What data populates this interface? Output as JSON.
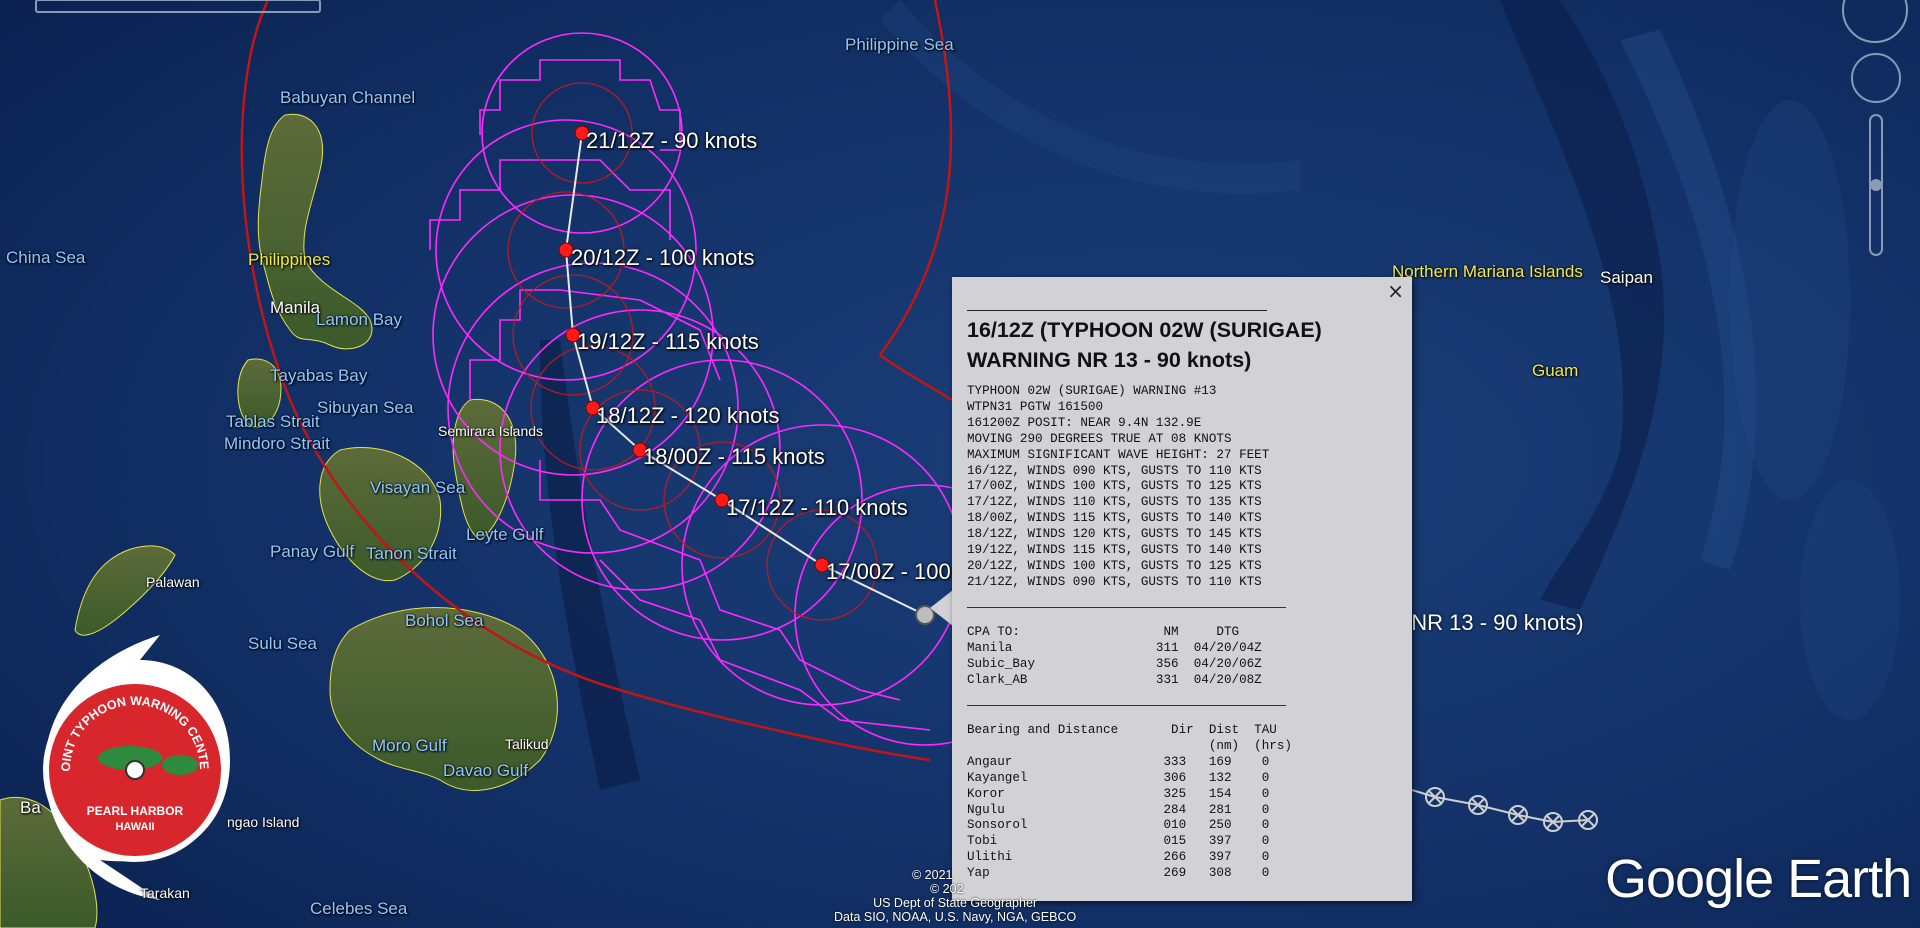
{
  "map_labels": [
    {
      "id": "philippine-sea",
      "text": "Philippine Sea",
      "kind": "water"
    },
    {
      "id": "babuyan-channel",
      "text": "Babuyan Channel",
      "kind": "water"
    },
    {
      "id": "china-sea",
      "text": "China Sea",
      "kind": "water"
    },
    {
      "id": "philippines",
      "text": "Philippines",
      "kind": "land"
    },
    {
      "id": "manila",
      "text": "Manila",
      "kind": "white"
    },
    {
      "id": "lamon-bay",
      "text": "Lamon Bay",
      "kind": "water"
    },
    {
      "id": "tayabas-bay",
      "text": "Tayabas Bay",
      "kind": "water"
    },
    {
      "id": "sibuyan-sea",
      "text": "Sibuyan Sea",
      "kind": "water"
    },
    {
      "id": "tablas-strait",
      "text": "Tablas Strait",
      "kind": "water"
    },
    {
      "id": "semirara-islands",
      "text": "Semirara Islands",
      "kind": "white"
    },
    {
      "id": "mindoro-strait",
      "text": "Mindoro Strait",
      "kind": "water"
    },
    {
      "id": "visayan-sea",
      "text": "Visayan Sea",
      "kind": "water"
    },
    {
      "id": "leyte-gulf",
      "text": "Leyte Gulf",
      "kind": "water"
    },
    {
      "id": "panay-gulf",
      "text": "Panay Gulf",
      "kind": "water"
    },
    {
      "id": "tanon-strait",
      "text": "Tanon Strait",
      "kind": "water"
    },
    {
      "id": "palawan",
      "text": "Palawan",
      "kind": "white"
    },
    {
      "id": "bohol-sea",
      "text": "Bohol Sea",
      "kind": "water"
    },
    {
      "id": "sulu-sea",
      "text": "Sulu Sea",
      "kind": "water"
    },
    {
      "id": "moro-gulf",
      "text": "Moro Gulf",
      "kind": "water"
    },
    {
      "id": "talikud",
      "text": "Talikud",
      "kind": "white"
    },
    {
      "id": "davao-gulf",
      "text": "Davao Gulf",
      "kind": "water"
    },
    {
      "id": "ngao-island",
      "text": "ngao Island",
      "kind": "white"
    },
    {
      "id": "tarakan",
      "text": "Tarakan",
      "kind": "white"
    },
    {
      "id": "celebes-sea",
      "text": "Celebes Sea",
      "kind": "water"
    },
    {
      "id": "ba",
      "text": "Ba",
      "kind": "white"
    },
    {
      "id": "northern-mariana-islands",
      "text": "Northern Mariana Islands",
      "kind": "land"
    },
    {
      "id": "saipan",
      "text": "Saipan",
      "kind": "white"
    },
    {
      "id": "guam",
      "text": "Guam",
      "kind": "land"
    }
  ],
  "forecast_points": [
    {
      "id": "fc-21-12z",
      "label": "21/12Z - 90 knots"
    },
    {
      "id": "fc-20-12z",
      "label": "20/12Z - 100 knots"
    },
    {
      "id": "fc-19-12z",
      "label": "19/12Z - 115 knots"
    },
    {
      "id": "fc-18-12z",
      "label": "18/12Z - 120 knots"
    },
    {
      "id": "fc-18-00z",
      "label": "18/00Z - 115 knots"
    },
    {
      "id": "fc-17-12z",
      "label": "17/12Z - 110 knots"
    },
    {
      "id": "fc-17-00z",
      "label": "17/00Z - 100"
    }
  ],
  "overflow_label": "G NR 13    - 90 knots)",
  "popup": {
    "close": "×",
    "title": "16/12Z (TYPHOON 02W (SURIGAE) WARNING NR 13 - 90 knots)",
    "warning_text": "TYPHOON 02W (SURIGAE) WARNING #13\nWTPN31 PGTW 161500\n161200Z POSIT: NEAR 9.4N 132.9E\nMOVING 290 DEGREES TRUE AT 08 KNOTS\nMAXIMUM SIGNIFICANT WAVE HEIGHT: 27 FEET\n16/12Z, WINDS 090 KTS, GUSTS TO 110 KTS\n17/00Z, WINDS 100 KTS, GUSTS TO 125 KTS\n17/12Z, WINDS 110 KTS, GUSTS TO 135 KTS\n18/00Z, WINDS 115 KTS, GUSTS TO 140 KTS\n18/12Z, WINDS 120 KTS, GUSTS TO 145 KTS\n19/12Z, WINDS 115 KTS, GUSTS TO 140 KTS\n20/12Z, WINDS 100 KTS, GUSTS TO 125 KTS\n21/12Z, WINDS 090 KTS, GUSTS TO 110 KTS",
    "cpa_text": "CPA TO:                   NM     DTG\nManila                   311  04/20/04Z\nSubic_Bay                356  04/20/06Z\nClark_AB                 331  04/20/08Z",
    "bearing_text": "Bearing and Distance       Dir  Dist  TAU\n                                (nm)  (hrs)\nAngaur                    333   169    0\nKayangel                  306   132    0\nKoror                     325   154    0\nNgulu                     284   281    0\nSonsorol                  010   250    0\nTobi                      015   397    0\nUlithi                    266   397    0\nYap                       269   308    0"
  },
  "jtwc_logo": {
    "line1": "JOINT TYPHOON WARNING CENTER",
    "line2": "PEARL HARBOR",
    "line3": "HAWAII"
  },
  "attribution": {
    "line1": "© 2021",
    "line2": "© 202",
    "line3": "US Dept of State Geographer",
    "line4": "Data SIO, NOAA, U.S. Navy, NGA, GEBCO"
  },
  "logo": "Google Earth",
  "colors": {
    "ocean": "#0d2a5c",
    "track": "#ff00ff",
    "danger": "#cc1111",
    "land": "#3f5a2a",
    "borders": "#e6e24a"
  }
}
